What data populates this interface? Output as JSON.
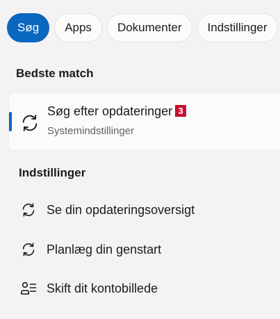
{
  "tabs": [
    {
      "label": "Søg",
      "active": true
    },
    {
      "label": "Apps",
      "active": false
    },
    {
      "label": "Dokumenter",
      "active": false
    },
    {
      "label": "Indstillinger",
      "active": false
    }
  ],
  "best_match": {
    "heading": "Bedste match",
    "title": "Søg efter opdateringer",
    "badge": "3",
    "subtitle": "Systemindstillinger",
    "icon": "refresh-icon"
  },
  "settings": {
    "heading": "Indstillinger",
    "items": [
      {
        "label": "Se din opdateringsoversigt",
        "icon": "refresh-icon"
      },
      {
        "label": "Planlæg din genstart",
        "icon": "refresh-icon"
      },
      {
        "label": "Skift dit kontobillede",
        "icon": "account-picture-icon"
      }
    ]
  },
  "colors": {
    "accent": "#0a67c0",
    "badge": "#c8102e",
    "background": "#f3f3f3"
  }
}
